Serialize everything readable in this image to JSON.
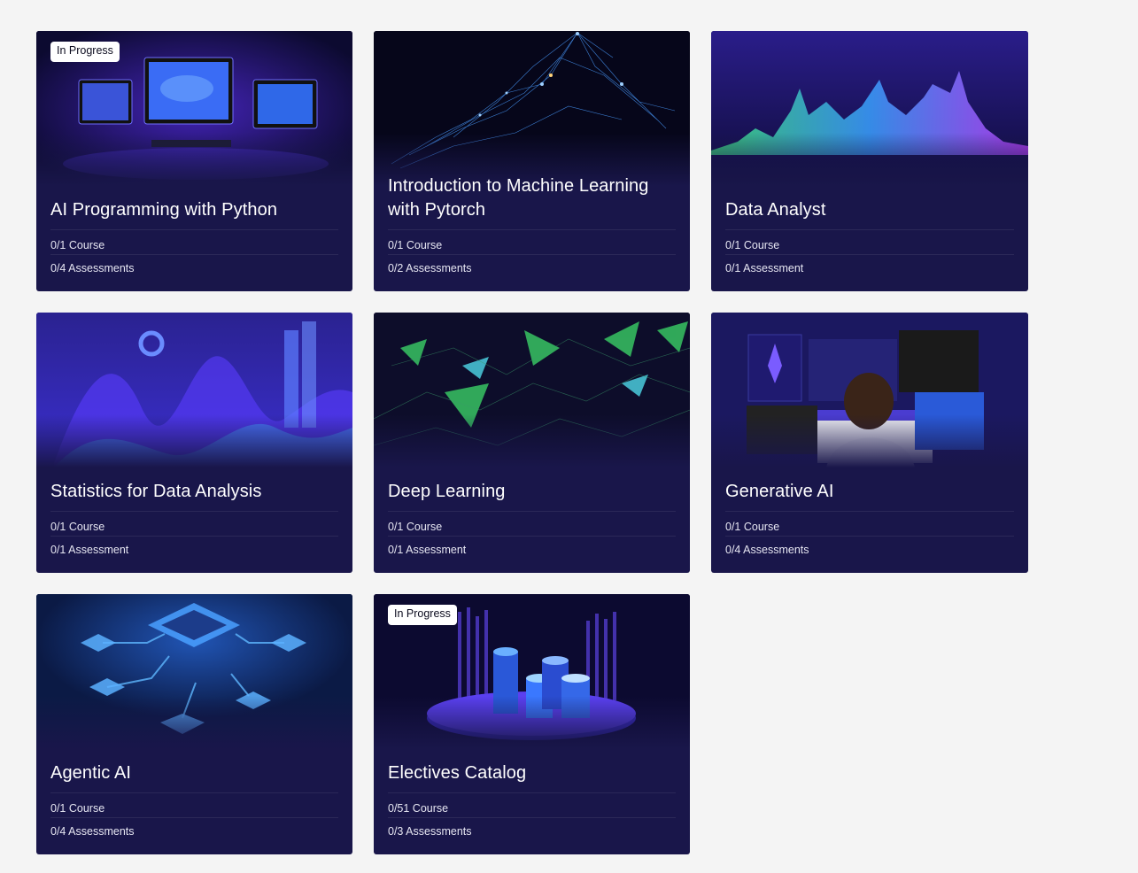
{
  "programs": [
    {
      "title": "AI Programming with Python",
      "status": "In Progress",
      "courses": "0/1 Course",
      "assessments": "0/4 Assessments",
      "image_icon": "computer-monitors-image"
    },
    {
      "title": "Introduction to Machine Learning with Pytorch",
      "status": "",
      "courses": "0/1 Course",
      "assessments": "0/2 Assessments",
      "image_icon": "network-mesh-image"
    },
    {
      "title": "Data Analyst",
      "status": "",
      "courses": "0/1 Course",
      "assessments": "0/1 Assessment",
      "image_icon": "waveform-chart-image"
    },
    {
      "title": "Statistics for Data Analysis",
      "status": "",
      "courses": "0/1 Course",
      "assessments": "0/1 Assessment",
      "image_icon": "statistics-chart-image"
    },
    {
      "title": "Deep Learning",
      "status": "",
      "courses": "0/1 Course",
      "assessments": "0/1 Assessment",
      "image_icon": "polygon-network-image"
    },
    {
      "title": "Generative AI",
      "status": "",
      "courses": "0/1 Course",
      "assessments": "0/4 Assessments",
      "image_icon": "person-at-screens-image"
    },
    {
      "title": "Agentic AI",
      "status": "",
      "courses": "0/1 Course",
      "assessments": "0/4 Assessments",
      "image_icon": "chip-network-image"
    },
    {
      "title": "Electives Catalog",
      "status": "In Progress",
      "courses": "0/51 Course",
      "assessments": "0/3 Assessments",
      "image_icon": "cylinder-data-image"
    }
  ],
  "colors": {
    "page_bg": "#f4f4f4",
    "card_bg": "#19164a",
    "badge_bg": "#ffffff"
  }
}
